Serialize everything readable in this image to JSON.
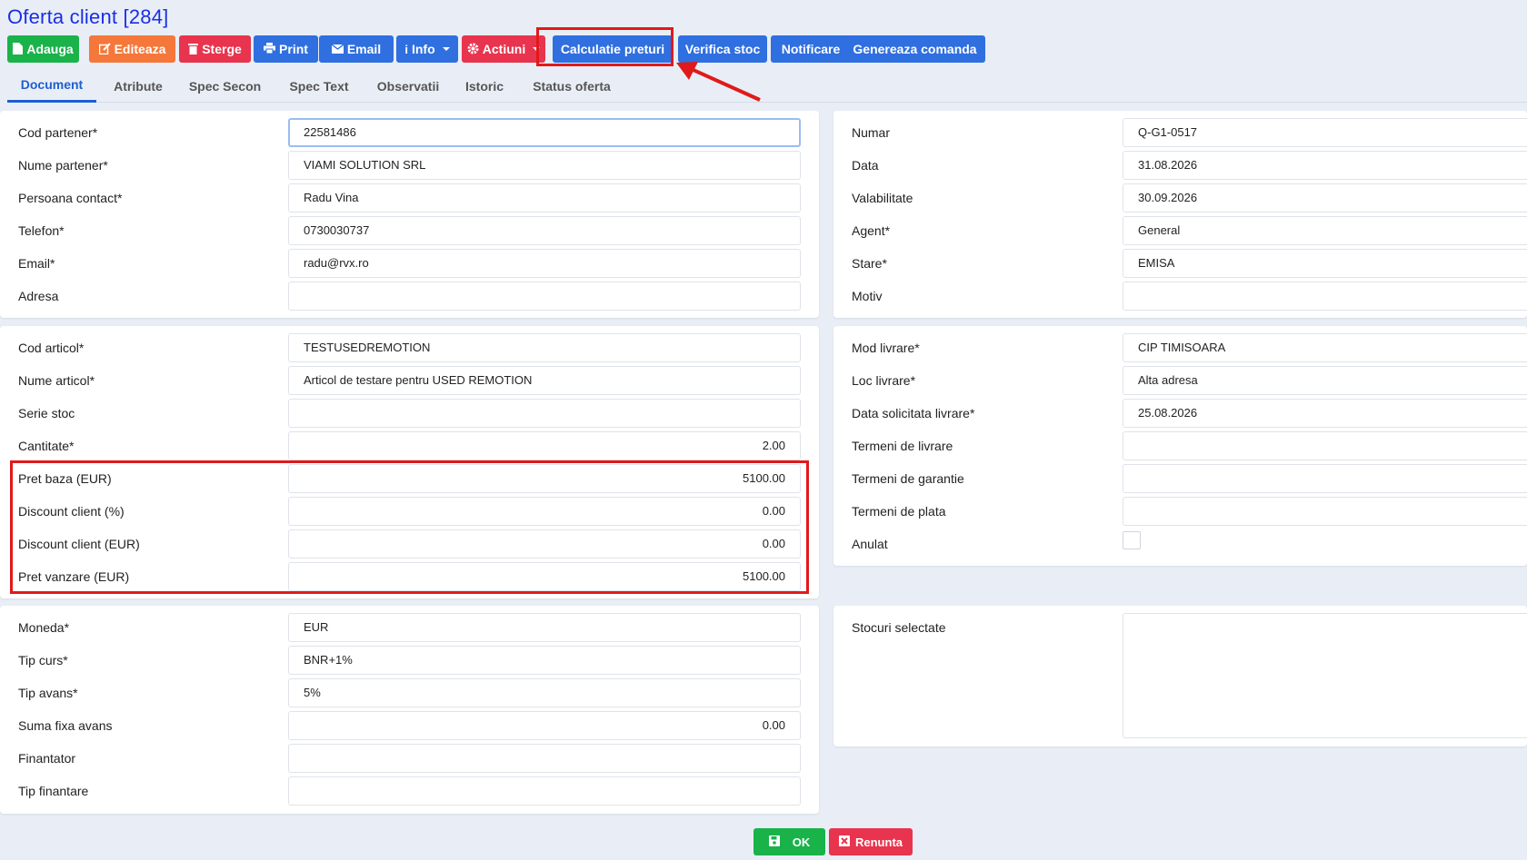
{
  "page": {
    "title": "Oferta client [284]"
  },
  "toolbar": {
    "buttons": [
      {
        "label": "Adauga",
        "icon": "file-icon"
      },
      {
        "label": "Editeaza",
        "icon": "edit-icon"
      },
      {
        "label": "Sterge",
        "icon": "trash-icon"
      },
      {
        "label": "Print",
        "icon": "print-icon"
      },
      {
        "label": "Email",
        "icon": "envelope-icon"
      },
      {
        "label": "Info",
        "icon": "info-icon"
      },
      {
        "label": "Actiuni",
        "icon": "gear-icon"
      },
      {
        "label": "Calculatie preturi"
      },
      {
        "label": "Verifica stoc"
      },
      {
        "label": "Notificare"
      },
      {
        "label": "Genereaza comanda"
      }
    ]
  },
  "tabs": [
    "Document",
    "Atribute",
    "Spec Secon",
    "Spec Text",
    "Observatii",
    "Istoric",
    "Status oferta"
  ],
  "left": {
    "partner": [
      {
        "label": "Cod partener*",
        "value": "22581486"
      },
      {
        "label": "Nume partener*",
        "value": "VIAMI SOLUTION SRL"
      },
      {
        "label": "Persoana contact*",
        "value": "Radu Vina"
      },
      {
        "label": "Telefon*",
        "value": "0730030737"
      },
      {
        "label": "Email*",
        "value": "radu@rvx.ro"
      },
      {
        "label": "Adresa",
        "value": ""
      }
    ],
    "article": [
      {
        "label": "Cod articol*",
        "value": "TESTUSEDREMOTION"
      },
      {
        "label": "Nume articol*",
        "value": "Articol de testare pentru USED REMOTION"
      },
      {
        "label": "Serie stoc",
        "value": ""
      },
      {
        "label": "Cantitate*",
        "value": "2.00"
      },
      {
        "label": "Pret baza (EUR)",
        "value": "5100.00"
      },
      {
        "label": "Discount client (%)",
        "value": "0.00"
      },
      {
        "label": "Discount client (EUR)",
        "value": "0.00"
      },
      {
        "label": "Pret vanzare (EUR)",
        "value": "5100.00"
      }
    ],
    "finance": [
      {
        "label": "Moneda*",
        "value": "EUR"
      },
      {
        "label": "Tip curs*",
        "value": "BNR+1%"
      },
      {
        "label": "Tip avans*",
        "value": "5%"
      },
      {
        "label": "Suma fixa avans",
        "value": "0.00"
      },
      {
        "label": "Finantator",
        "value": ""
      },
      {
        "label": "Tip finantare",
        "value": ""
      }
    ]
  },
  "right": {
    "doc": [
      {
        "label": "Numar",
        "value": "Q-G1-0517"
      },
      {
        "label": "Data",
        "value": "31.08.2026"
      },
      {
        "label": "Valabilitate",
        "value": "30.09.2026"
      },
      {
        "label": "Agent*",
        "value": "General"
      },
      {
        "label": "Stare*",
        "value": "EMISA"
      },
      {
        "label": "Motiv",
        "value": ""
      }
    ],
    "delivery": [
      {
        "label": "Mod livrare*",
        "value": "CIP TIMISOARA"
      },
      {
        "label": "Loc livrare*",
        "value": "Alta adresa"
      },
      {
        "label": "Data solicitata livrare*",
        "value": "25.08.2026"
      },
      {
        "label": "Termeni de livrare",
        "value": ""
      },
      {
        "label": "Termeni de garantie",
        "value": ""
      },
      {
        "label": "Termeni de plata",
        "value": ""
      },
      {
        "label": "Anulat",
        "value": ""
      }
    ],
    "stock": {
      "label": "Stocuri selectate",
      "value": ""
    }
  },
  "footer": {
    "ok_label": "OK",
    "cancel_label": "Renunta"
  },
  "colors": {
    "title": "#1a2fe6",
    "green": "#19b34a",
    "orange": "#f5773a",
    "red": "#e8344e",
    "blue": "#2f6fe0",
    "highlight": "#e01a1a",
    "tab_active": "#1e5fd0"
  }
}
